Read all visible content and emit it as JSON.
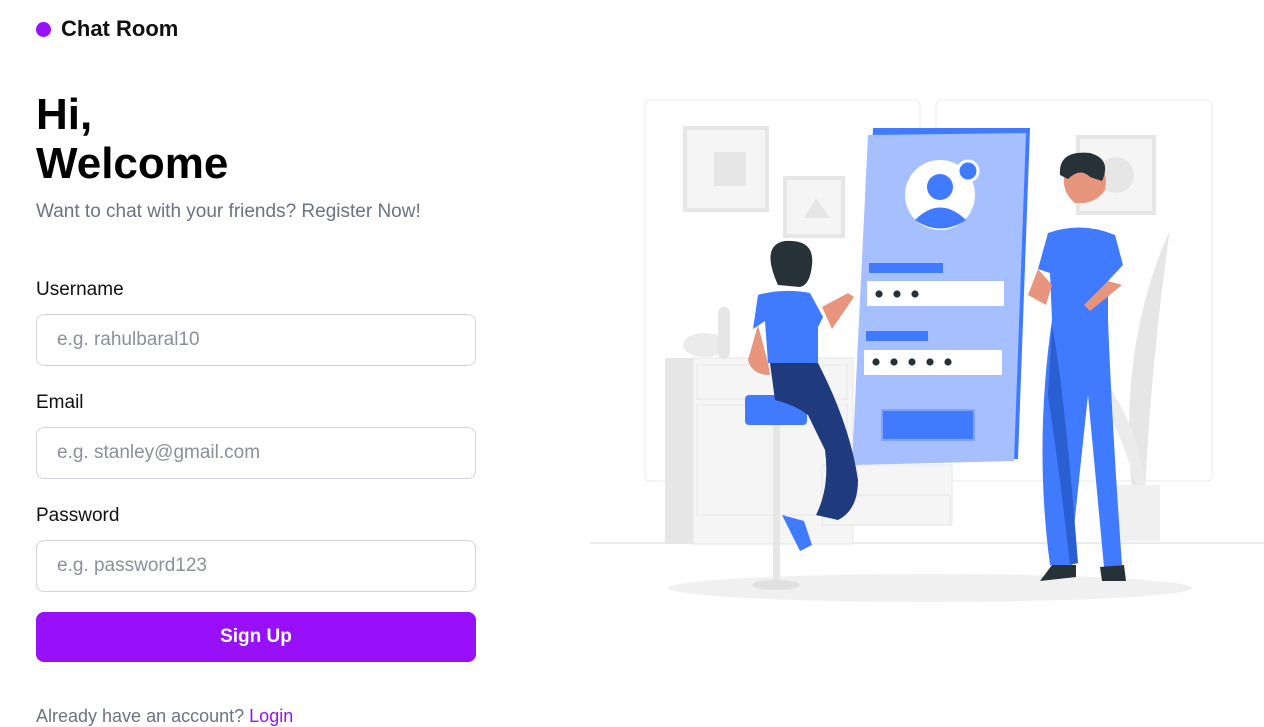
{
  "brand": {
    "name": "Chat Room",
    "color": "#9810fa"
  },
  "hero": {
    "line1": "Hi,",
    "line2": "Welcome",
    "subtitle": "Want to chat with your friends? Register Now!"
  },
  "form": {
    "username": {
      "label": "Username",
      "placeholder": "e.g. rahulbaral10",
      "value": ""
    },
    "email": {
      "label": "Email",
      "placeholder": "e.g. stanley@gmail.com",
      "value": ""
    },
    "password": {
      "label": "Password",
      "placeholder": "e.g. password123",
      "value": ""
    },
    "submit_label": "Sign Up"
  },
  "footer": {
    "prompt": "Already have an account?",
    "login_label": "Login"
  },
  "illustration": {
    "subject": "login-illustration",
    "accent": "#407bff",
    "shade": "#1f3a7d"
  }
}
